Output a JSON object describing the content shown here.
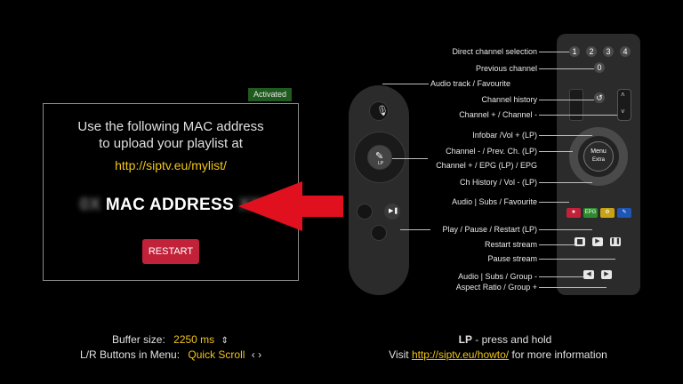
{
  "dialog": {
    "status_badge": "Activated",
    "instruction_line1": "Use the following MAC address",
    "instruction_line2": "to upload your playlist at",
    "url": "http://siptv.eu/mylist/",
    "mac_label": "MAC ADDRESS",
    "restart_label": "RESTART"
  },
  "settings": {
    "buffer_label": "Buffer size:",
    "buffer_value": "2250 ms",
    "lr_label": "L/R Buttons in Menu:",
    "lr_value": "Quick Scroll"
  },
  "footer": {
    "lp_key": "LP",
    "lp_text": " - press and hold",
    "visit_text": "Visit ",
    "visit_url": "http://siptv.eu/howto/",
    "visit_suffix": " for more information"
  },
  "remote_labels": {
    "direct_channel": "Direct channel selection",
    "previous_channel": "Previous channel",
    "audio_track": "Audio track / Favourite",
    "channel_history": "Channel history",
    "channel_plus_minus": "Channel + / Channel -",
    "infobar": "Infobar /Vol + (LP)",
    "channel_minus_prev": "Channel - / Prev. Ch. (LP)",
    "channel_plus_epg": "Channel + / EPG (LP) / EPG",
    "ch_history_vol": "Ch History / Vol - (LP)",
    "audio_subs_fav": "Audio | Subs / Favourite",
    "play_pause_restart": "Play / Pause / Restart (LP)",
    "restart_stream": "Restart stream",
    "pause_stream": "Pause stream",
    "audio_subs_group": "Audio | Subs / Group -",
    "aspect_ratio": "Aspect Ratio / Group +"
  },
  "remote_buttons": {
    "digits": [
      "1",
      "2",
      "3",
      "4"
    ],
    "zero": "0",
    "menu": "Menu",
    "extra": "Extra",
    "lp": "LP",
    "epg": "EPG"
  },
  "colors": {
    "accent_yellow": "#f0c419",
    "restart_red": "#c2213a",
    "arrow_red": "#e0101e",
    "badge_green": "#1f5a1f"
  }
}
